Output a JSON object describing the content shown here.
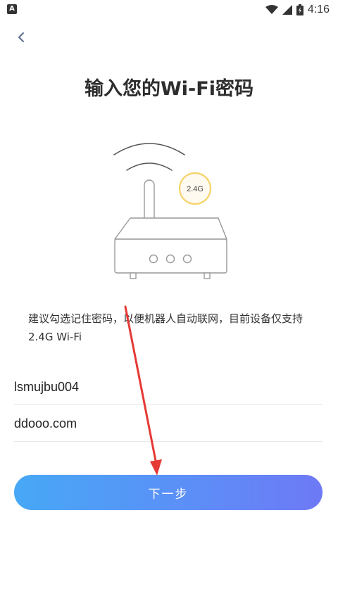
{
  "status_bar": {
    "time": "4:16"
  },
  "page": {
    "title": "输入您的Wi-Fi密码",
    "band_badge": "2.4G",
    "hint": "建议勾选记住密码，以便机器人自动联网，目前设备仅支持 2.4G Wi-Fi"
  },
  "form": {
    "ssid_value": "lsmujbu004",
    "password_value": "ddooo.com"
  },
  "actions": {
    "next_label": "下一步"
  },
  "colors": {
    "button_start": "#47a8f6",
    "button_end": "#6e79f5",
    "badge_ring": "#f5d36a",
    "annotation_arrow": "#e53935"
  }
}
